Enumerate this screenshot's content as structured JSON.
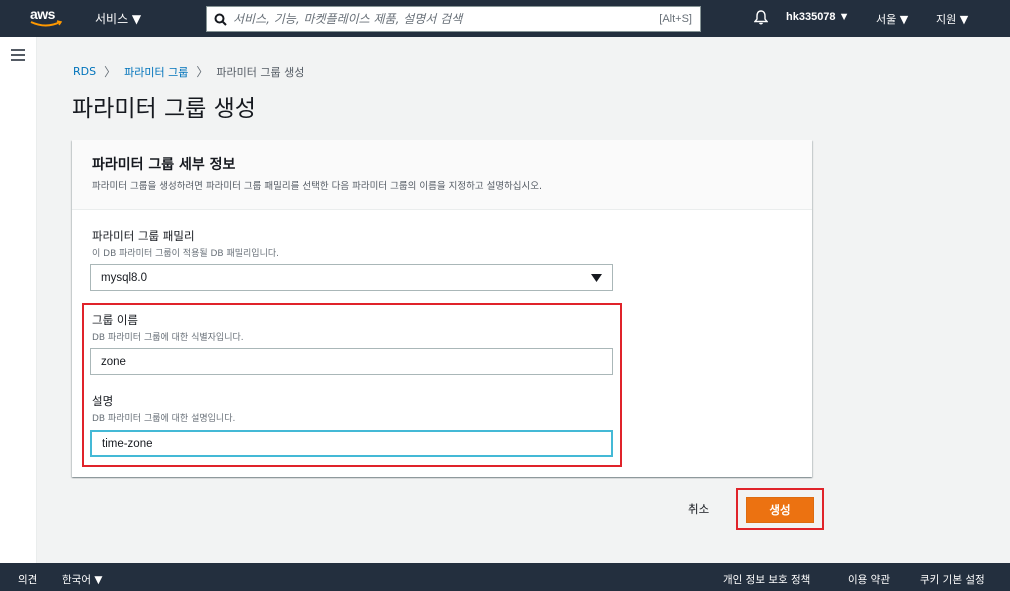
{
  "topnav": {
    "logo_text": "aws",
    "services_label": "서비스 ▼",
    "search_placeholder": "서비스, 기능, 마켓플레이스 제품, 설명서 검색",
    "search_shortcut": "[Alt+S]",
    "user_label": "hk335078 ▼",
    "region_label": "서울 ▼",
    "support_label": "지원 ▼"
  },
  "breadcrumb": {
    "items": [
      "RDS",
      "파라미터 그룹",
      "파라미터 그룹 생성"
    ],
    "separator": "〉"
  },
  "page": {
    "title": "파라미터 그룹 생성"
  },
  "panel": {
    "title": "파라미터 그룹 세부 정보",
    "description": "파라미터 그룹을 생성하려면 파라미터 그룹 패밀리를 선택한 다음 파라미터 그룹의 이름을 지정하고 설명하십시오.",
    "family": {
      "label": "파라미터 그룹 패밀리",
      "description": "이 DB 파라미터 그룹이 적용될 DB 패밀리입니다.",
      "value": "mysql8.0"
    },
    "group_name": {
      "label": "그룹 이름",
      "description": "DB 파라미터 그룹에 대한 식별자입니다.",
      "value": "zone"
    },
    "group_desc": {
      "label": "설명",
      "description": "DB 파라미터 그룹에 대한 설명입니다.",
      "value": "time-zone"
    }
  },
  "actions": {
    "cancel_label": "취소",
    "create_label": "생성"
  },
  "footer": {
    "feedback": "의견",
    "language": "한국어 ▼",
    "privacy": "개인 정보 보호 정책",
    "terms": "이용 약관",
    "cookie": "쿠키 기본 설정"
  },
  "colors": {
    "nav_bg": "#232f3e",
    "accent_orange": "#ec7211",
    "highlight_red": "#e0232a",
    "link_blue": "#0073bb",
    "focus_blue": "#44b9d6"
  }
}
